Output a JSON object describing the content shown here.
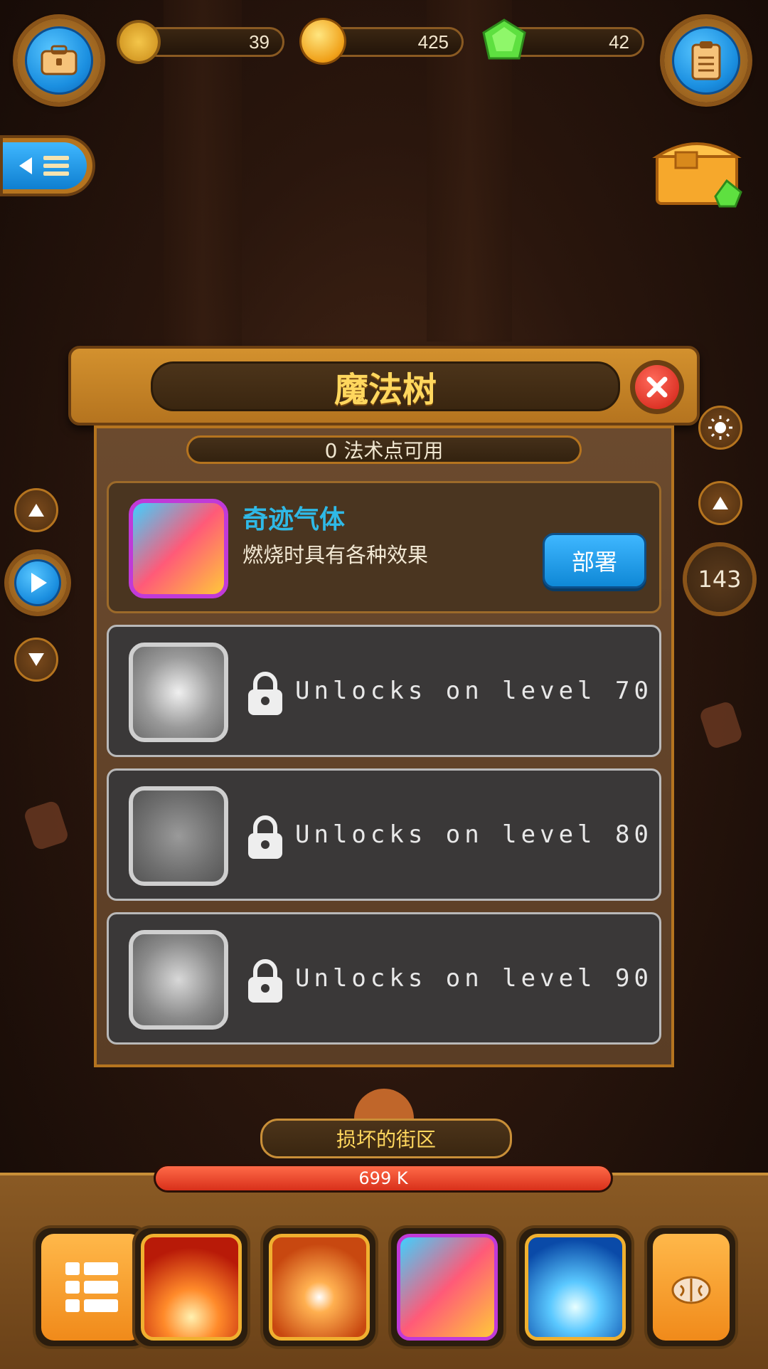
{
  "resources": {
    "gears": "39",
    "coins": "425",
    "gems": "42"
  },
  "panel": {
    "title": "魔法树",
    "points_text": "0 法术点可用",
    "active_skill": {
      "name": "奇迹气体",
      "description": "燃烧时具有各种效果",
      "button_label": "部署"
    },
    "locked_skills": [
      {
        "label": "Unlocks on level 70"
      },
      {
        "label": "Unlocks on level 80"
      },
      {
        "label": "Unlocks on level 90"
      }
    ]
  },
  "side": {
    "level_value": "143"
  },
  "hud": {
    "zone_name": "损坏的街区",
    "health_text": "699 K",
    "health_fraction": 1.0
  },
  "colors": {
    "accent_gold": "#ffd75e",
    "skill_name": "#2fb9e6",
    "deploy_button": "#1a9ae8",
    "health_bar": "#e8422a",
    "gem_green": "#5ee040"
  },
  "icons": {
    "top_left": "briefcase-icon",
    "top_right": "clipboard-icon",
    "menu": "back-menu-icon",
    "chest": "treasure-chest-icon",
    "close": "close-icon",
    "sun": "sun-icon",
    "lock": "lock-icon",
    "brain": "brain-icon",
    "list": "list-icon"
  }
}
